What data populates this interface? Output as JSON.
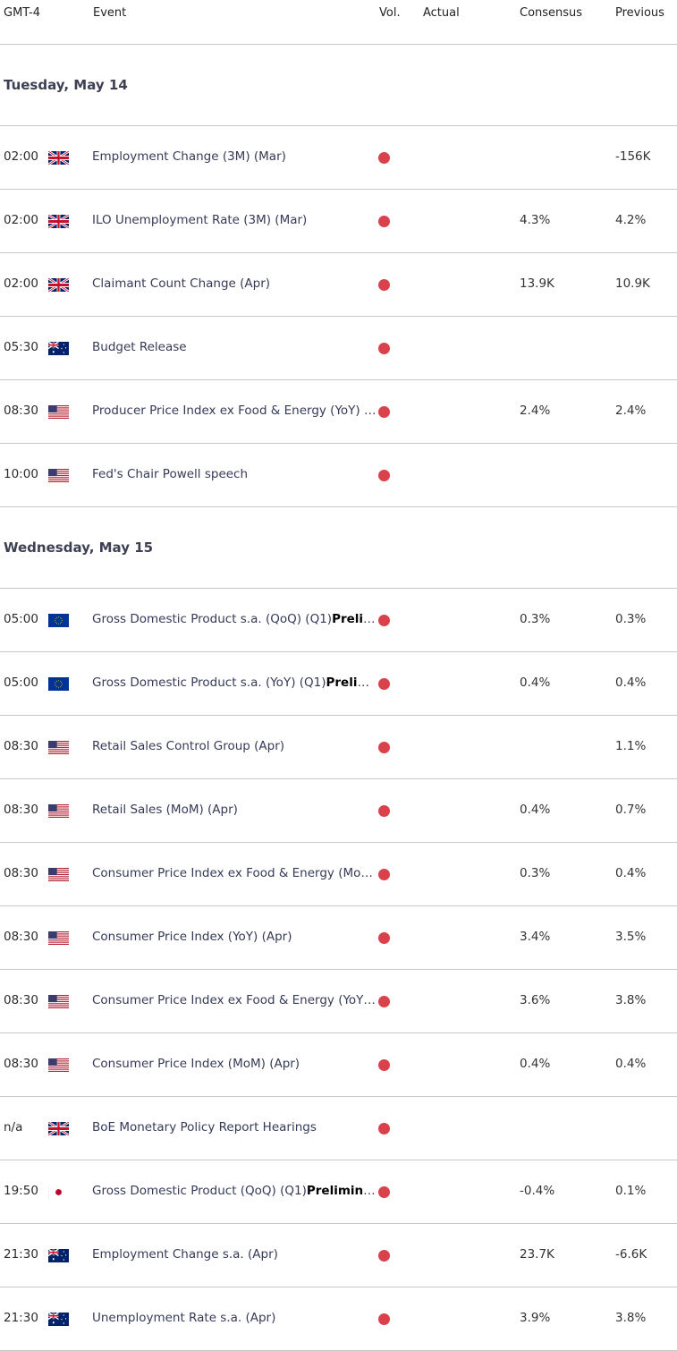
{
  "header": {
    "time": "GMT-4",
    "event": "Event",
    "vol": "Vol.",
    "actual": "Actual",
    "consensus": "Consensus",
    "previous": "Previous"
  },
  "colors": {
    "volatility_high": "#d9414b",
    "divider": "#c6c6c6"
  },
  "days": [
    {
      "label": "Tuesday, May 14",
      "events": [
        {
          "time": "02:00",
          "flag": "gb-flag-icon",
          "name": "Employment Change (3M) (Mar)",
          "bold": "",
          "actual": "",
          "consensus": "",
          "previous": "-156K"
        },
        {
          "time": "02:00",
          "flag": "gb-flag-icon",
          "name": "ILO Unemployment Rate (3M) (Mar)",
          "bold": "",
          "actual": "",
          "consensus": "4.3%",
          "previous": "4.2%"
        },
        {
          "time": "02:00",
          "flag": "gb-flag-icon",
          "name": "Claimant Count Change (Apr)",
          "bold": "",
          "actual": "",
          "consensus": "13.9K",
          "previous": "10.9K"
        },
        {
          "time": "05:30",
          "flag": "au-flag-icon",
          "name": "Budget Release",
          "bold": "",
          "actual": "",
          "consensus": "",
          "previous": ""
        },
        {
          "time": "08:30",
          "flag": "us-flag-icon",
          "name": "Producer Price Index ex Food & Energy (YoY) (Apr)",
          "bold": "",
          "actual": "",
          "consensus": "2.4%",
          "previous": "2.4%"
        },
        {
          "time": "10:00",
          "flag": "us-flag-icon",
          "name": "Fed's Chair Powell speech",
          "bold": "",
          "actual": "",
          "consensus": "",
          "previous": ""
        }
      ]
    },
    {
      "label": "Wednesday, May 15",
      "events": [
        {
          "time": "05:00",
          "flag": "eu-flag-icon",
          "name": "Gross Domestic Product s.a. (QoQ) (Q1)",
          "bold": "Preliminary",
          "actual": "",
          "consensus": "0.3%",
          "previous": "0.3%"
        },
        {
          "time": "05:00",
          "flag": "eu-flag-icon",
          "name": "Gross Domestic Product s.a. (YoY) (Q1)",
          "bold": "Preliminary",
          "actual": "",
          "consensus": "0.4%",
          "previous": "0.4%"
        },
        {
          "time": "08:30",
          "flag": "us-flag-icon",
          "name": "Retail Sales Control Group (Apr)",
          "bold": "",
          "actual": "",
          "consensus": "",
          "previous": "1.1%"
        },
        {
          "time": "08:30",
          "flag": "us-flag-icon",
          "name": "Retail Sales (MoM) (Apr)",
          "bold": "",
          "actual": "",
          "consensus": "0.4%",
          "previous": "0.7%"
        },
        {
          "time": "08:30",
          "flag": "us-flag-icon",
          "name": "Consumer Price Index ex Food & Energy (MoM) (Apr)",
          "bold": "",
          "actual": "",
          "consensus": "0.3%",
          "previous": "0.4%"
        },
        {
          "time": "08:30",
          "flag": "us-flag-icon",
          "name": "Consumer Price Index (YoY) (Apr)",
          "bold": "",
          "actual": "",
          "consensus": "3.4%",
          "previous": "3.5%"
        },
        {
          "time": "08:30",
          "flag": "us-flag-icon",
          "name": "Consumer Price Index ex Food & Energy (YoY) (Apr)",
          "bold": "",
          "actual": "",
          "consensus": "3.6%",
          "previous": "3.8%"
        },
        {
          "time": "08:30",
          "flag": "us-flag-icon",
          "name": "Consumer Price Index (MoM) (Apr)",
          "bold": "",
          "actual": "",
          "consensus": "0.4%",
          "previous": "0.4%"
        },
        {
          "time": "n/a",
          "flag": "gb-flag-icon",
          "name": "BoE Monetary Policy Report Hearings",
          "bold": "",
          "actual": "",
          "consensus": "",
          "previous": ""
        },
        {
          "time": "19:50",
          "flag": "jp-flag-icon",
          "name": "Gross Domestic Product (QoQ) (Q1)",
          "bold": "Preliminary",
          "actual": "",
          "consensus": "-0.4%",
          "previous": "0.1%"
        },
        {
          "time": "21:30",
          "flag": "au-flag-icon",
          "name": "Employment Change s.a. (Apr)",
          "bold": "",
          "actual": "",
          "consensus": "23.7K",
          "previous": "-6.6K"
        },
        {
          "time": "21:30",
          "flag": "au-flag-icon",
          "name": "Unemployment Rate s.a. (Apr)",
          "bold": "",
          "actual": "",
          "consensus": "3.9%",
          "previous": "3.8%"
        }
      ]
    }
  ]
}
